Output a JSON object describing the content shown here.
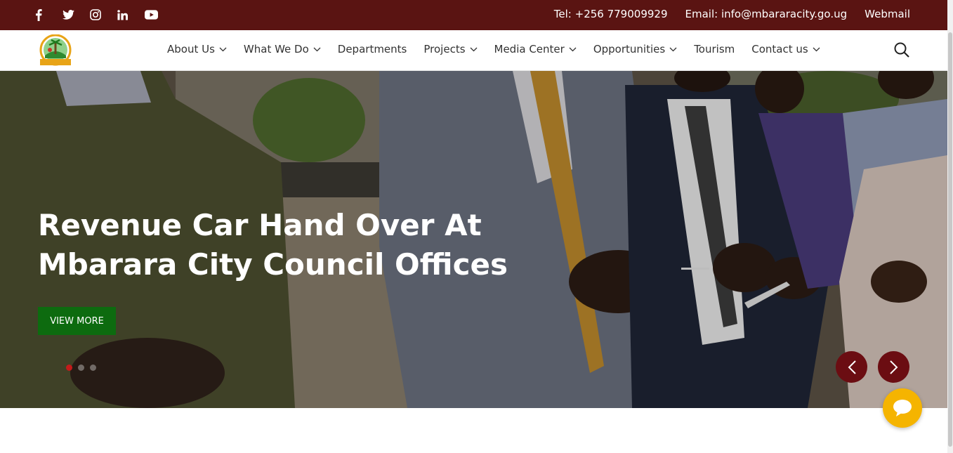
{
  "topbar": {
    "social_icons": [
      "facebook-icon",
      "twitter-icon",
      "instagram-icon",
      "linkedin-icon",
      "youtube-icon"
    ],
    "phone": "Tel: +256 779009929",
    "email": "Email: info@mbararacity.go.ug",
    "webmail": "Webmail",
    "bg_color": "#5a1412"
  },
  "nav": {
    "logo_text": "MBARARA CITY",
    "items": [
      {
        "label": "About Us",
        "has_dropdown": true
      },
      {
        "label": "What We Do",
        "has_dropdown": true
      },
      {
        "label": "Departments",
        "has_dropdown": false
      },
      {
        "label": "Projects",
        "has_dropdown": true
      },
      {
        "label": "Media Center",
        "has_dropdown": true
      },
      {
        "label": "Opportunities",
        "has_dropdown": true
      },
      {
        "label": "Tourism",
        "has_dropdown": false
      },
      {
        "label": "Contact us",
        "has_dropdown": true
      }
    ]
  },
  "hero": {
    "headline": "Revenue Car Hand Over At Mbarara City Council Offices",
    "button_label": "VIEW MORE",
    "button_color": "#0d6b0f",
    "slide_count": 3,
    "active_slide": 1,
    "arrow_color": "#6b0d12"
  },
  "chat": {
    "icon": "chat-bubble-icon",
    "color": "#f5b400"
  }
}
